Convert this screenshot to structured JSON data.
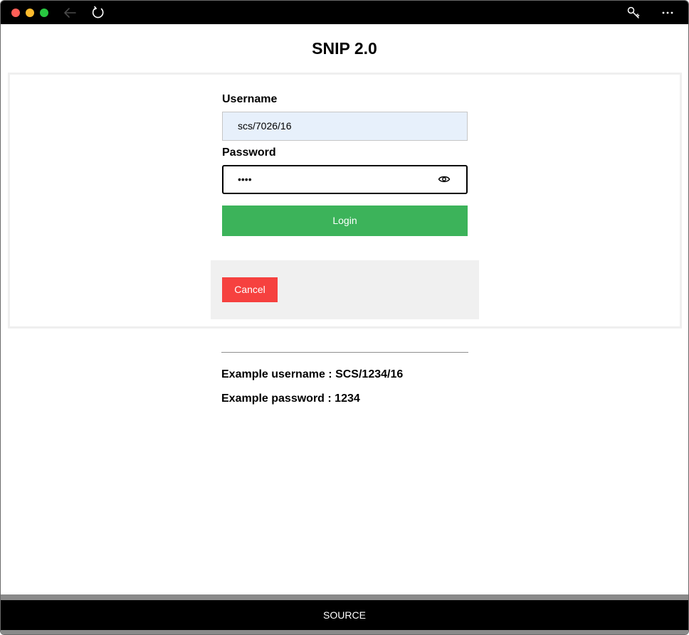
{
  "window": {
    "controls": {
      "close_color": "#ff5f57",
      "minimize_color": "#febc2e",
      "zoom_color": "#28c840"
    },
    "toolbar_icons": [
      "back-arrow-icon",
      "reload-icon",
      "key-icon",
      "more-icon"
    ]
  },
  "page": {
    "title": "SNIP 2.0"
  },
  "form": {
    "username_label": "Username",
    "username_value": "scs/7026/16",
    "password_label": "Password",
    "password_masked": "••••",
    "login_label": "Login",
    "cancel_label": "Cancel"
  },
  "examples": {
    "username": "Example username : SCS/1234/16",
    "password": "Example password : 1234"
  },
  "footer": {
    "label": "SOURCE"
  },
  "colors": {
    "login_button": "#3cb35a",
    "cancel_button": "#f6413f",
    "username_field": "#e7f0fb"
  }
}
